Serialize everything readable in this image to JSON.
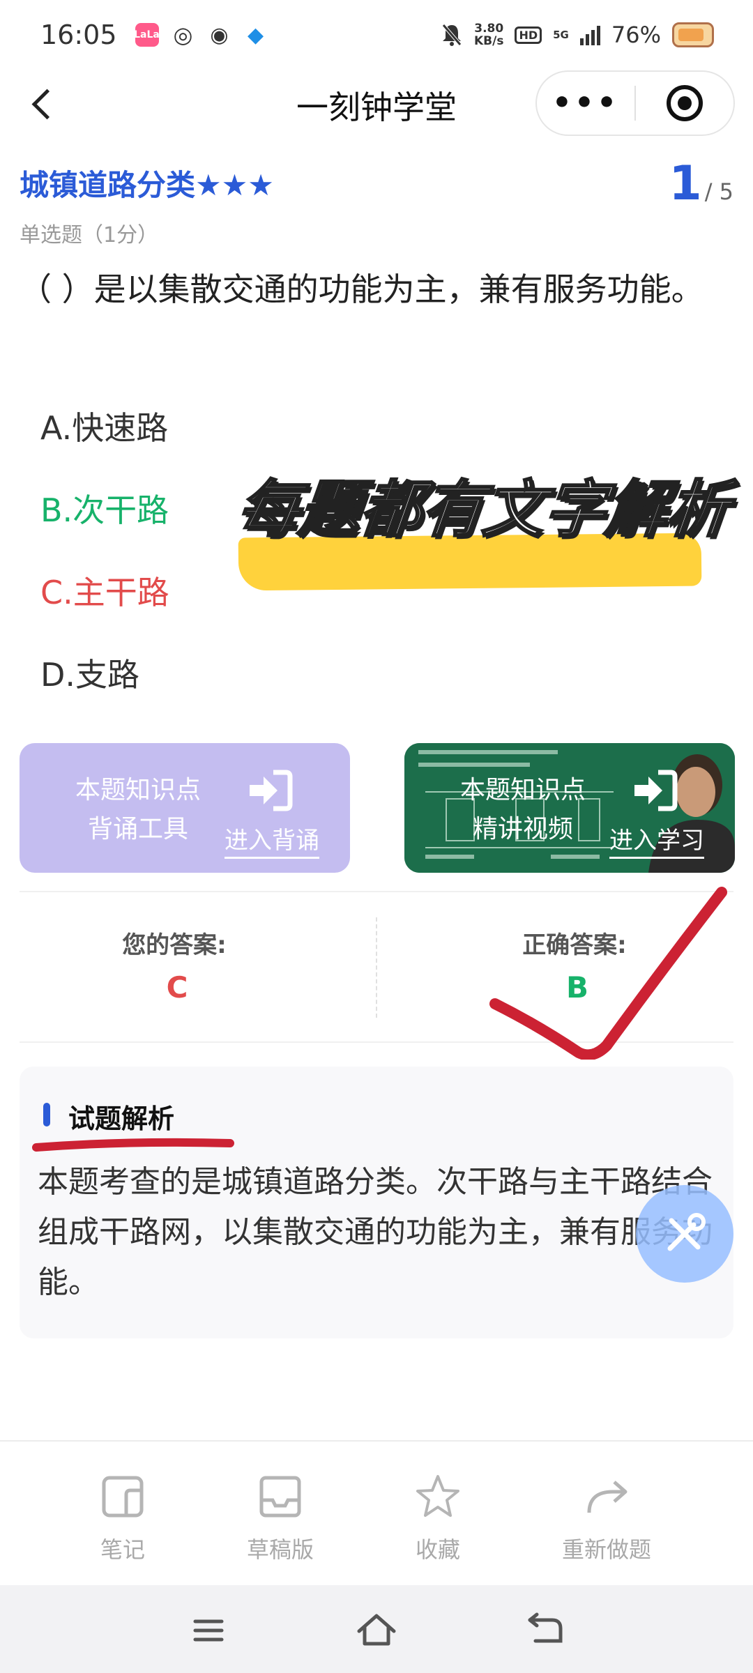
{
  "status_bar": {
    "time": "16:05",
    "net_speed_value": "3.80",
    "net_speed_unit": "KB/s",
    "hd_label": "HD",
    "network": "5G",
    "battery": "76%"
  },
  "header": {
    "title": "一刻钟学堂",
    "more_label": "•••"
  },
  "question": {
    "category": "城镇道路分类★★★",
    "current": "1",
    "total": "/ 5",
    "type": "单选题（1分）",
    "text": "（ ）是以集散交通的功能为主，兼有服务功能。",
    "options": [
      {
        "label": "A.快速路",
        "state": "normal"
      },
      {
        "label": "B.次干路",
        "state": "correct"
      },
      {
        "label": "C.主干路",
        "state": "wrong"
      },
      {
        "label": "D.支路",
        "state": "normal"
      }
    ]
  },
  "promo": {
    "text": "每题都有文字解析",
    "highlight_color": "#ffd23c"
  },
  "cards": {
    "recite": {
      "title_line1": "本题知识点",
      "title_line2": "背诵工具",
      "link": "进入背诵"
    },
    "video": {
      "title_line1": "本题知识点",
      "title_line2": "精讲视频",
      "link": "进入学习"
    }
  },
  "answers": {
    "yours_label": "您的答案:",
    "yours_value": "C",
    "correct_label": "正确答案:",
    "correct_value": "B"
  },
  "analysis": {
    "title": "试题解析",
    "text": "本题考查的是城镇道路分类。次干路与主干路结合组成干路网，以集散交通的功能为主，兼有服务功能。"
  },
  "toolbar": {
    "note": "笔记",
    "draft": "草稿版",
    "favorite": "收藏",
    "redo": "重新做题"
  },
  "colors": {
    "accent": "#2b5bd7",
    "correct": "#17b26a",
    "wrong": "#e24b4b",
    "recite_card": "#c4bdf0",
    "video_card": "#1c6e4b"
  }
}
